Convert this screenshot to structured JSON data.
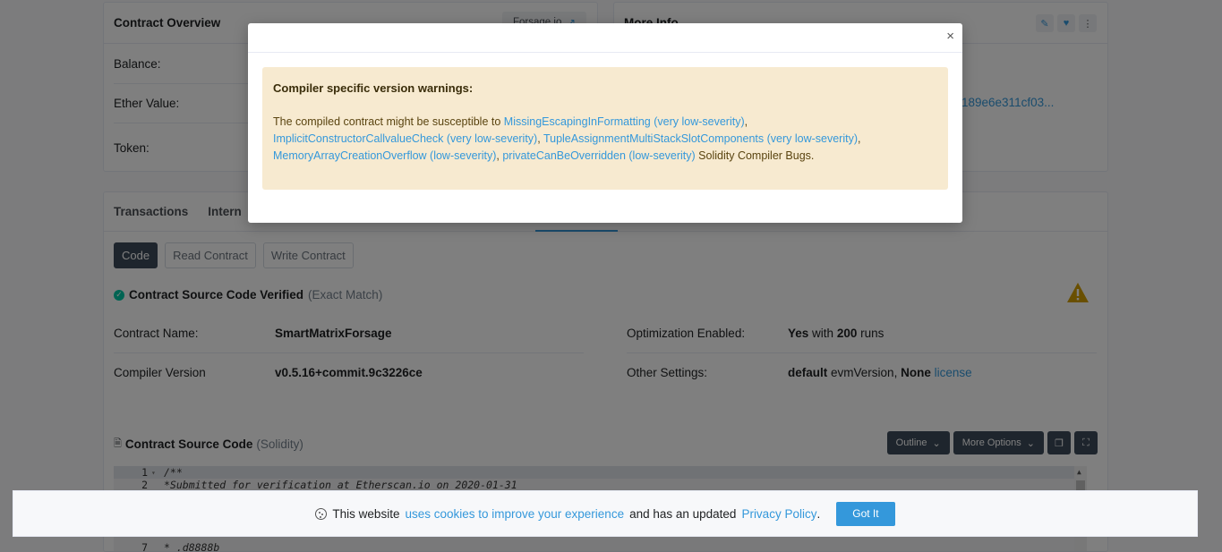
{
  "overview": {
    "title": "Contract Overview",
    "tag": "Forsage.io",
    "balance_label": "Balance:",
    "ether_label": "Ether Value:",
    "token_label": "Token:"
  },
  "more_info": {
    "title": "More Info",
    "hash_fragment": "189e6e311cf03..."
  },
  "tabs": [
    "Transactions",
    "Intern"
  ],
  "code_buttons": {
    "code": "Code",
    "read": "Read Contract",
    "write": "Write Contract"
  },
  "verified": {
    "title": "Contract Source Code Verified",
    "match": "(Exact Match)"
  },
  "details": {
    "contract_name_label": "Contract Name:",
    "contract_name": "SmartMatrixForsage",
    "compiler_label": "Compiler Version",
    "compiler": "v0.5.16+commit.9c3226ce",
    "optimization_label": "Optimization Enabled:",
    "optimization_yes": "Yes",
    "optimization_with": "with",
    "optimization_runs": "200",
    "optimization_runs_word": "runs",
    "settings_label": "Other Settings:",
    "settings_default": "default",
    "settings_evm": "evmVersion,",
    "settings_none": "None",
    "settings_license": "license"
  },
  "source": {
    "title": "Contract Source Code",
    "lang": "(Solidity)",
    "outline": "Outline",
    "more_options": "More Options"
  },
  "code_lines": [
    {
      "n": "1",
      "text": "/**"
    },
    {
      "n": "2",
      "text": " *Submitted for verification at Etherscan.io on 2020-01-31"
    },
    {
      "n": "7",
      "text": " *   ,d8888b"
    }
  ],
  "modal": {
    "close": "×",
    "title": "Compiler specific version warnings:",
    "intro": "The compiled contract might be susceptible to",
    "bug1": "MissingEscapingInFormatting (very low-severity)",
    "bug2": "ImplicitConstructorCallvalueCheck (very low-severity)",
    "bug3": "TupleAssignmentMultiStackSlotComponents (very low-severity)",
    "bug4": "MemoryArrayCreationOverflow (low-severity)",
    "bug5": "privateCanBeOverridden (low-severity)",
    "sep": ",",
    "outro": "Solidity Compiler Bugs."
  },
  "cookie": {
    "pre": "This website",
    "link1": "uses cookies to improve your experience",
    "mid": "and has an updated",
    "link2": "Privacy Policy",
    "dot": ".",
    "button": "Got It"
  }
}
